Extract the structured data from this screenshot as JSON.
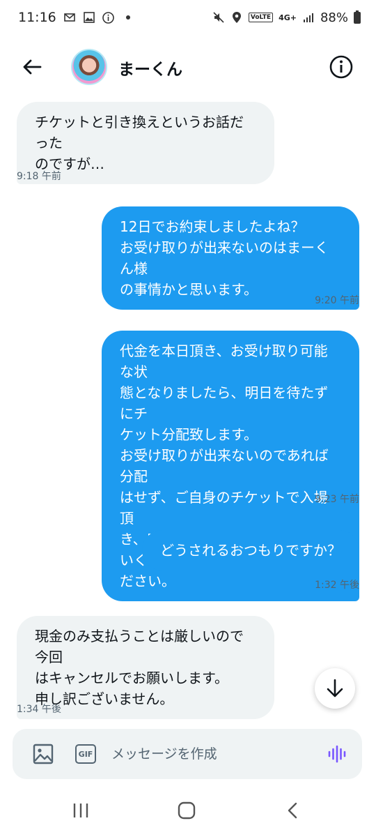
{
  "status_bar": {
    "time": "11:16",
    "battery": "88%",
    "network": "4G+",
    "volte": "VoLTE"
  },
  "header": {
    "contact_name": "まーくん"
  },
  "messages": [
    {
      "text": "チケットと引き換えというお話だった\nのですが…",
      "time": "9:18 午前",
      "direction": "in"
    },
    {
      "text": "12日でお約束しましたよね？\nお受け取りが出来ないのはまーくん様\nの事情かと思います。",
      "time": "9:20 午前",
      "direction": "out"
    },
    {
      "text": "代金を本日頂き、お受け取り可能な状\n態となりましたら、明日を待たずにチ\nケット分配致します。\nお受け取りが出来ないのであれば分配\nはせず、ご自身のチケットで入場頂\nき、席はお譲り予定の場所をお使いく\nださい。",
      "time": "9:23 午前",
      "direction": "out"
    },
    {
      "text": "どうされるおつもりですか？",
      "time": "1:32 午後",
      "direction": "out"
    },
    {
      "text": "現金のみ支払うことは厳しいので今回\nはキャンセルでお願いします。\n申し訳ございません。",
      "time": "1:34 午後",
      "direction": "in"
    }
  ],
  "composer": {
    "placeholder": "メッセージを作成",
    "gif_label": "GIF"
  },
  "colors": {
    "accent": "#1d9bf0",
    "incoming_bubble": "#eff3f4",
    "voice_icon": "#7856ff"
  }
}
